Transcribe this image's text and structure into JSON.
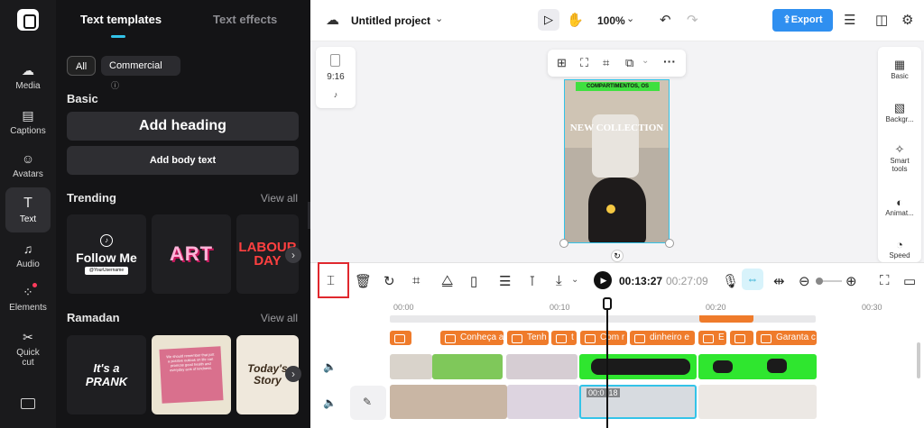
{
  "rail": {
    "items": [
      {
        "label": "Media",
        "icon": "media-upload-icon"
      },
      {
        "label": "Captions",
        "icon": "captions-icon"
      },
      {
        "label": "Avatars",
        "icon": "avatars-icon"
      },
      {
        "label": "Text",
        "icon": "text-icon"
      },
      {
        "label": "Audio",
        "icon": "audio-icon"
      },
      {
        "label": "Elements",
        "icon": "elements-icon"
      },
      {
        "label": "Quick cut",
        "icon": "quick-cut-icon"
      }
    ]
  },
  "panel": {
    "tab_templates": "Text templates",
    "tab_effects": "Text effects",
    "filter_all": "All",
    "filter_commercial": "Commercial",
    "basic_title": "Basic",
    "add_heading": "Add heading",
    "add_body": "Add body text",
    "trending_title": "Trending",
    "view_all": "View all",
    "trending_cards": [
      "Follow Me",
      "ART",
      "LABOUR DAY"
    ],
    "follow_handle": "@YourUsername",
    "ramadan_title": "Ramadan",
    "ramadan_cards": [
      "It's a PRANK",
      "We should remember that just a positive outlook on life can promote good health and everyday acts of kindness.",
      "Today's Story"
    ]
  },
  "topbar": {
    "project_name": "Untitled project",
    "zoom": "100%",
    "export_label": "Export"
  },
  "canvas": {
    "aspect_label": "9:16",
    "video_text_top": "COMPARTIMENTOS, OS",
    "video_text_mid": "NEW COLLECTION",
    "side_tools": [
      {
        "label": "Basic",
        "icon": "basic-icon"
      },
      {
        "label": "Backgr...",
        "icon": "background-icon"
      },
      {
        "label": "Smart tools",
        "icon": "smart-tools-icon"
      },
      {
        "label": "Animat...",
        "icon": "animation-icon"
      },
      {
        "label": "Speed",
        "icon": "speed-icon"
      }
    ]
  },
  "timeline": {
    "current_time": "00:13:27",
    "total_time": "00:27:09",
    "ruler": [
      "00:00",
      "00:10",
      "00:20",
      "00:30"
    ],
    "text_clips": [
      "Conheça a",
      "Tenh",
      "t",
      "Com r",
      "dinheiro e",
      "E",
      "Garanta c"
    ],
    "clip_time": "00:0 :18"
  },
  "colors": {
    "accent": "#2f8ff0",
    "clip_orange": "#ef7b2b",
    "green_screen": "#2fe62f",
    "playhead": "#111111",
    "selection": "#33c3e8",
    "highlight_box": "#e0282e"
  }
}
